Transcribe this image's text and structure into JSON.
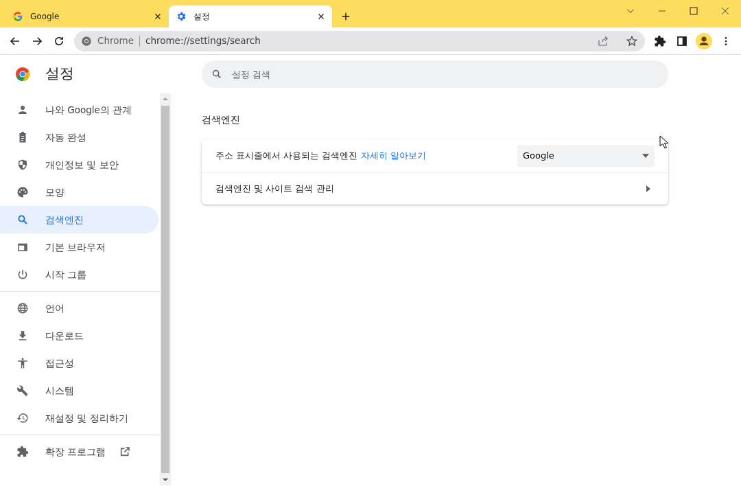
{
  "tabs": [
    {
      "label": "Google",
      "kind": "google",
      "selected": false
    },
    {
      "label": "설정",
      "kind": "settings",
      "selected": true
    }
  ],
  "address_bar": {
    "site_label": "Chrome",
    "url": "chrome://settings/search"
  },
  "page_title": "설정",
  "search": {
    "placeholder": "설정 검색"
  },
  "sidebar": {
    "groups": [
      {
        "items": [
          {
            "label": "나와 Google의 관계",
            "kind": "page",
            "selected": false
          },
          {
            "label": "자동 완성",
            "kind": "page",
            "selected": false
          },
          {
            "label": "개인정보 및 보안",
            "kind": "page",
            "selected": false
          },
          {
            "label": "모양",
            "kind": "page",
            "selected": false
          },
          {
            "label": "검색엔진",
            "kind": "page",
            "selected": true
          },
          {
            "label": "기본 브라우저",
            "kind": "page",
            "selected": false
          },
          {
            "label": "시작 그룹",
            "kind": "page",
            "selected": false
          }
        ]
      },
      {
        "items": [
          {
            "label": "언어",
            "kind": "page",
            "selected": false
          },
          {
            "label": "다운로드",
            "kind": "page",
            "selected": false
          },
          {
            "label": "접근성",
            "kind": "page",
            "selected": false
          },
          {
            "label": "시스템",
            "kind": "page",
            "selected": false
          },
          {
            "label": "재설정 및 정리하기",
            "kind": "page",
            "selected": false
          }
        ]
      },
      {
        "items": [
          {
            "label": "확장 프로그램",
            "kind": "external",
            "selected": false
          }
        ]
      }
    ]
  },
  "section": {
    "title": "검색엔진",
    "rows": [
      {
        "kind": "select",
        "label": "주소 표시줄에서 사용되는 검색엔진",
        "link": "자세히 알아보기",
        "value": "Google"
      },
      {
        "kind": "link",
        "label": "검색엔진 및 사이트 검색 관리"
      }
    ]
  }
}
